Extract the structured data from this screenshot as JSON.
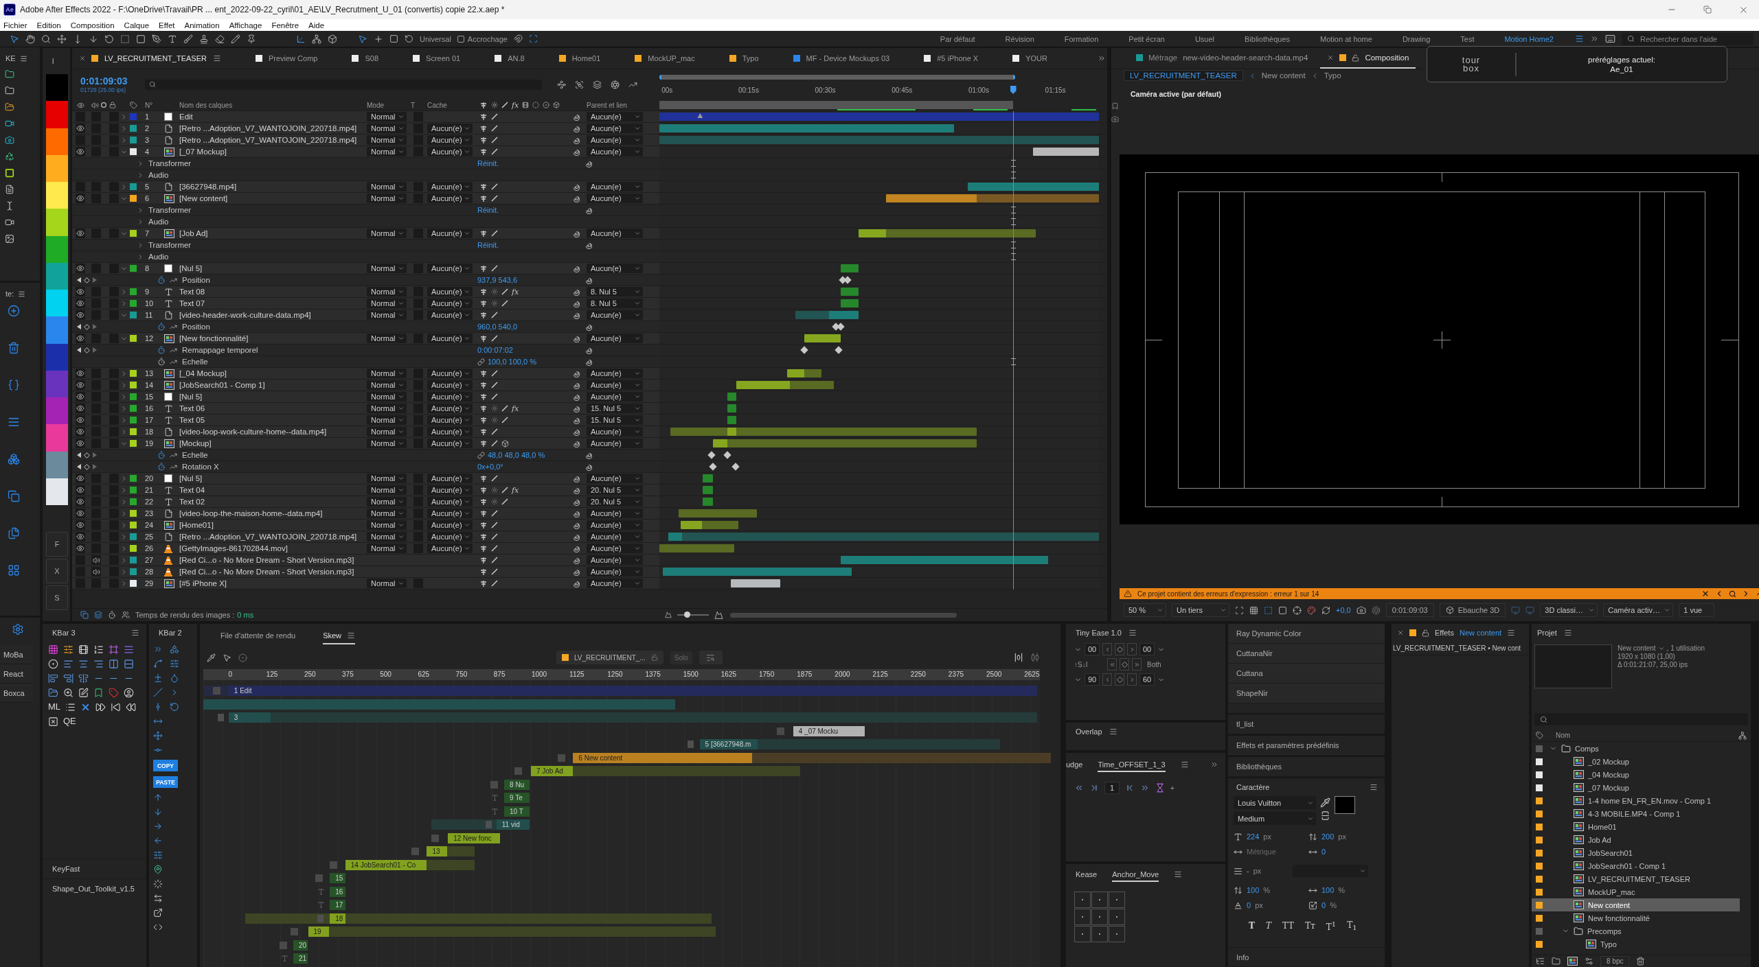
{
  "window": {
    "logo": "Ae",
    "title": "Adobe After Effects 2022 - F:\\OneDrive\\Travail\\PR ... ent_2022-09-22_cyril\\01_AE\\LV_Recrutment_U_01 (convertis) copie  22.x.aep *"
  },
  "menu": [
    "Fichier",
    "Edition",
    "Composition",
    "Calque",
    "Effet",
    "Animation",
    "Affichage",
    "Fenêtre",
    "Aide"
  ],
  "toolbar": {
    "snap_mode": "Universal",
    "snapping": {
      "label": "Accrochage",
      "checked": false
    },
    "workspaces": [
      {
        "label": "Par défaut",
        "selected": false
      },
      {
        "label": "Révision",
        "selected": false
      },
      {
        "label": "Formation",
        "selected": false
      },
      {
        "label": "Petit écran",
        "selected": false
      },
      {
        "label": "Usuel",
        "selected": false
      },
      {
        "label": "Bibliothèques",
        "selected": false
      },
      {
        "label": "Motion at home",
        "selected": false
      },
      {
        "label": "Drawing",
        "selected": false
      },
      {
        "label": "Test",
        "selected": false
      },
      {
        "label": "Motion Home2",
        "selected": true
      }
    ],
    "help_search": {
      "placeholder": "Rechercher dans l'aide"
    }
  },
  "side_strip": {
    "top_title": "KE",
    "middle_title": "te:",
    "buttons": [
      "MoBa",
      "React",
      "Boxca"
    ]
  },
  "label_palette": {
    "title": "l",
    "swatches": [
      {
        "color": "#000000"
      },
      {
        "color": "#e60000"
      },
      {
        "color": "#ff6a00"
      },
      {
        "color": "#ffad1f"
      },
      {
        "color": "#ffe94d"
      },
      {
        "color": "#a6d61c"
      },
      {
        "color": "#20ab26"
      },
      {
        "color": "#11a39b"
      },
      {
        "color": "#00d2f0"
      },
      {
        "color": "#2a86ec"
      },
      {
        "color": "#1c2fab"
      },
      {
        "color": "#6a33bd"
      },
      {
        "color": "#a523b4"
      },
      {
        "color": "#e93a9c"
      },
      {
        "color": "#6b8a9b"
      },
      {
        "color": "#e4e8ec"
      }
    ],
    "buttons": [
      "F",
      "X",
      "S"
    ]
  },
  "timeline": {
    "tabs": [
      {
        "label": "LV_RECRUITMENT_TEASER",
        "color": "#f5a623",
        "selected": true
      },
      {
        "label": "Preview Comp",
        "color": "#eeeeee",
        "selected": false
      },
      {
        "label": "S08",
        "color": "#eeeeee",
        "selected": false
      },
      {
        "label": "Screen 01",
        "color": "#eeeeee",
        "selected": false
      },
      {
        "label": "AN.8",
        "color": "#eeeeee",
        "selected": false
      },
      {
        "label": "Home01",
        "color": "#f5a623",
        "selected": false
      },
      {
        "label": "MockUP_mac",
        "color": "#f5a623",
        "selected": false
      },
      {
        "label": "Typo",
        "color": "#f5a623",
        "selected": false
      },
      {
        "label": "MF - Device Mockups 03",
        "color": "#2a86ec",
        "selected": false
      },
      {
        "label": "#5 iPhone X",
        "color": "#eeeeee",
        "selected": false
      },
      {
        "label": "YOUR",
        "color": "#eeeeee",
        "selected": false
      }
    ],
    "current_time": "0:01:09:03",
    "frame_info": "01728 (25.00 ips)",
    "ruler": [
      "00s",
      "00:15s",
      "00:30s",
      "00:45s",
      "01:00s",
      "01:15s"
    ],
    "columns": {
      "number": "N°",
      "name": "Nom des calques",
      "mode": "Mode",
      "track_matte": "T",
      "matte": "Cache",
      "effects": "fx",
      "parent": "Parent et lien"
    },
    "layers": [
      {
        "number": "1",
        "name": "Edit",
        "kind": "solid",
        "color": "#1f35c0",
        "visible": false,
        "audio": false,
        "expanded": false,
        "fx": false,
        "three_d": false,
        "mode": "Normal",
        "parent": "Aucun(e)"
      },
      {
        "number": "2",
        "name": "[Retro ...Adoption_V7_WANTOJOIN_220718.mp4]",
        "kind": "footage",
        "color": "#1a9a94",
        "visible": true,
        "audio": false,
        "expanded": false,
        "fx": false,
        "three_d": false,
        "mode": "Normal",
        "cache": "Aucun(e)",
        "parent": "Aucun(e)"
      },
      {
        "number": "3",
        "name": "[Retro ...Adoption_V7_WANTOJOIN_220718.mp4]",
        "kind": "footage",
        "color": "#1a9a94",
        "visible": false,
        "audio": false,
        "expanded": false,
        "fx": false,
        "three_d": false,
        "mode": "Normal",
        "cache": "Aucun(e)",
        "parent": "Aucun(e)"
      },
      {
        "number": "4",
        "name": "[_07 Mockup]",
        "kind": "comp",
        "color": "#e8e8e8",
        "visible": true,
        "audio": false,
        "expanded": true,
        "fx": false,
        "three_d": false,
        "mode": "Normal",
        "cache": "Aucun(e)",
        "parent": "Aucun(e)",
        "children": [
          {
            "name": "Transformer",
            "kind": "group",
            "value": "Réinit."
          },
          {
            "name": "Audio",
            "kind": "group"
          }
        ]
      },
      {
        "number": "5",
        "name": "[36627948.mp4]",
        "kind": "footage",
        "color": "#1a9a94",
        "visible": false,
        "audio": false,
        "expanded": false,
        "fx": false,
        "three_d": false,
        "mode": "Normal",
        "cache": "Aucun(e)",
        "parent": "Aucun(e)"
      },
      {
        "number": "6",
        "name": "[New content]",
        "kind": "comp",
        "color": "#f5a41f",
        "visible": true,
        "audio": false,
        "expanded": true,
        "fx": false,
        "three_d": false,
        "mode": "Normal",
        "cache": "Aucun(e)",
        "parent": "Aucun(e)",
        "children": [
          {
            "name": "Transformer",
            "kind": "group",
            "value": "Réinit."
          },
          {
            "name": "Audio",
            "kind": "group"
          }
        ]
      },
      {
        "number": "7",
        "name": "[Job Ad]",
        "kind": "comp",
        "color": "#a6d11c",
        "visible": true,
        "audio": false,
        "expanded": true,
        "fx": false,
        "three_d": false,
        "mode": "Normal",
        "cache": "Aucun(e)",
        "parent": "Aucun(e)",
        "children": [
          {
            "name": "Transformer",
            "kind": "group",
            "value": "Réinit."
          },
          {
            "name": "Audio",
            "kind": "group"
          }
        ]
      },
      {
        "number": "8",
        "name": "[Nul 5]",
        "kind": "solid",
        "color": "#26a82d",
        "visible": true,
        "audio": false,
        "expanded": true,
        "fx": false,
        "three_d": false,
        "mode": "Normal",
        "cache": "Aucun(e)",
        "parent": "Aucun(e)",
        "children": [
          {
            "name": "Position",
            "kind": "property",
            "value": "937,9 543,6",
            "keyframed": true,
            "linked": false
          }
        ]
      },
      {
        "number": "9",
        "name": "Text 08",
        "kind": "text",
        "color": "#26a82d",
        "visible": true,
        "audio": false,
        "expanded": false,
        "fx": true,
        "fx_label": "fx",
        "three_d": false,
        "mode": "Normal",
        "cache": "Aucun(e)",
        "parent": "8. Nul 5"
      },
      {
        "number": "10",
        "name": "Text 07",
        "kind": "text",
        "color": "#26a82d",
        "visible": true,
        "audio": false,
        "expanded": false,
        "fx": false,
        "three_d": false,
        "mode": "Normal",
        "cache": "Aucun(e)",
        "parent": "8. Nul 5"
      },
      {
        "number": "11",
        "name": "[video-header-work-culture-data.mp4]",
        "kind": "footage",
        "color": "#1a9a94",
        "visible": true,
        "audio": false,
        "expanded": true,
        "fx": false,
        "three_d": false,
        "mode": "Normal",
        "cache": "Aucun(e)",
        "parent": "Aucun(e)",
        "children": [
          {
            "name": "Position",
            "kind": "property",
            "value": "960,0 540,0",
            "keyframed": true,
            "linked": false
          }
        ]
      },
      {
        "number": "12",
        "name": "[New fonctionnalité]",
        "kind": "comp",
        "color": "#a6d11c",
        "visible": true,
        "audio": false,
        "expanded": true,
        "fx": false,
        "three_d": false,
        "mode": "Normal",
        "cache": "Aucun(e)",
        "parent": "Aucun(e)",
        "children": [
          {
            "name": "Remappage temporel",
            "kind": "property",
            "value": "0:00:07:02",
            "keyframed": true,
            "linked": false
          },
          {
            "name": "Echelle",
            "kind": "property",
            "value": "100,0 100,0 %",
            "keyframed": false,
            "linked": true
          }
        ]
      },
      {
        "number": "13",
        "name": "[_04 Mockup]",
        "kind": "comp",
        "color": "#a6d11c",
        "visible": true,
        "audio": false,
        "expanded": false,
        "fx": false,
        "three_d": false,
        "mode": "Normal",
        "cache": "Aucun(e)",
        "parent": "Aucun(e)"
      },
      {
        "number": "14",
        "name": "[JobSearch01 - Comp 1]",
        "kind": "comp",
        "color": "#a6d11c",
        "visible": true,
        "audio": false,
        "expanded": false,
        "fx": false,
        "three_d": false,
        "mode": "Normal",
        "cache": "Aucun(e)",
        "parent": "Aucun(e)"
      },
      {
        "number": "15",
        "name": "[Nul 5]",
        "kind": "solid",
        "color": "#26a82d",
        "visible": true,
        "audio": false,
        "expanded": false,
        "fx": false,
        "three_d": false,
        "mode": "Normal",
        "cache": "Aucun(e)",
        "parent": "Aucun(e)"
      },
      {
        "number": "16",
        "name": "Text 06",
        "kind": "text",
        "color": "#26a82d",
        "visible": true,
        "audio": false,
        "expanded": false,
        "fx": true,
        "fx_label": "fx",
        "three_d": false,
        "mode": "Normal",
        "cache": "Aucun(e)",
        "parent": "15. Nul 5"
      },
      {
        "number": "17",
        "name": "Text 05",
        "kind": "text",
        "color": "#26a82d",
        "visible": true,
        "audio": false,
        "expanded": false,
        "fx": false,
        "three_d": false,
        "mode": "Normal",
        "cache": "Aucun(e)",
        "parent": "15. Nul 5"
      },
      {
        "number": "18",
        "name": "[video-loop-work-culture-home--data.mp4]",
        "kind": "footage",
        "color": "#a6d11c",
        "visible": true,
        "audio": false,
        "expanded": false,
        "fx": false,
        "three_d": false,
        "mode": "Normal",
        "cache": "Aucun(e)",
        "parent": "Aucun(e)"
      },
      {
        "number": "19",
        "name": "[Mockup]",
        "kind": "comp",
        "color": "#a6d11c",
        "visible": true,
        "audio": false,
        "expanded": true,
        "fx": false,
        "three_d": true,
        "mode": "Normal",
        "cache": "Aucun(e)",
        "parent": "Aucun(e)",
        "children": [
          {
            "name": "Echelle",
            "kind": "property",
            "value": "48,0 48,0 48,0 %",
            "keyframed": true,
            "linked": true
          },
          {
            "name": "Rotation X",
            "kind": "property",
            "value": "0x+0,0°",
            "keyframed": true,
            "linked": false
          }
        ]
      },
      {
        "number": "20",
        "name": "[Nul 5]",
        "kind": "solid",
        "color": "#26a82d",
        "visible": true,
        "audio": false,
        "expanded": false,
        "fx": false,
        "three_d": false,
        "mode": "Normal",
        "cache": "Aucun(e)",
        "parent": "Aucun(e)"
      },
      {
        "number": "21",
        "name": "Text 04",
        "kind": "text",
        "color": "#26a82d",
        "visible": true,
        "audio": false,
        "expanded": false,
        "fx": true,
        "fx_label": "fx",
        "three_d": false,
        "mode": "Normal",
        "cache": "Aucun(e)",
        "parent": "20. Nul 5"
      },
      {
        "number": "22",
        "name": "Text 02",
        "kind": "text",
        "color": "#26a82d",
        "visible": true,
        "audio": false,
        "expanded": false,
        "fx": false,
        "three_d": false,
        "mode": "Normal",
        "cache": "Aucun(e)",
        "parent": "20. Nul 5"
      },
      {
        "number": "23",
        "name": "[video-loop-the-maison-home--data.mp4]",
        "kind": "footage",
        "color": "#a6d11c",
        "visible": true,
        "audio": false,
        "expanded": false,
        "fx": false,
        "three_d": false,
        "mode": "Normal",
        "cache": "Aucun(e)",
        "parent": "Aucun(e)"
      },
      {
        "number": "24",
        "name": "[Home01]",
        "kind": "comp",
        "color": "#a6d11c",
        "visible": true,
        "audio": false,
        "expanded": false,
        "fx": false,
        "three_d": false,
        "mode": "Normal",
        "cache": "Aucun(e)",
        "parent": "Aucun(e)"
      },
      {
        "number": "25",
        "name": "[Retro ...Adoption_V7_WANTOJOIN_220718.mp4]",
        "kind": "footage",
        "color": "#1a9a94",
        "visible": true,
        "audio": false,
        "expanded": false,
        "fx": false,
        "three_d": false,
        "mode": "Normal",
        "cache": "Aucun(e)",
        "parent": "Aucun(e)"
      },
      {
        "number": "26",
        "name": "[GettyImages-861702844.mov]",
        "kind": "media",
        "color": "#a6d11c",
        "visible": true,
        "audio": false,
        "expanded": false,
        "fx": false,
        "three_d": false,
        "mode": "Normal",
        "cache": "Aucun(e)",
        "parent": "Aucun(e)"
      },
      {
        "number": "27",
        "name": "[Red Ci...o - No More Dream - Short Version.mp3]",
        "kind": "media",
        "color": "#1a9a94",
        "visible": false,
        "audio": true,
        "expanded": false,
        "fx": false,
        "three_d": false,
        "parent": "Aucun(e)"
      },
      {
        "number": "28",
        "name": "[Red Ci...o - No More Dream - Short Version.mp3]",
        "kind": "media",
        "color": "#1a9a94",
        "visible": false,
        "audio": true,
        "expanded": false,
        "fx": false,
        "three_d": false,
        "parent": "Aucun(e)"
      },
      {
        "number": "29",
        "name": "[#5 iPhone X]",
        "kind": "comp",
        "color": "#e6ecf0",
        "visible": false,
        "audio": false,
        "expanded": false,
        "fx": false,
        "three_d": false,
        "mode": "Normal",
        "parent": "Aucun(e)"
      }
    ],
    "zoom_slider": {
      "level": 0.3
    },
    "render_time": {
      "label": "Temps de rendu des images :",
      "value": "0 ms"
    }
  },
  "viewer": {
    "tabs": [
      {
        "kind": "footage",
        "label": "Métrage",
        "file": "new-video-header-search-data.mp4",
        "color": "#1a9a94",
        "selected": false
      },
      {
        "kind": "composition",
        "label": "Composition",
        "color": "#f5a623",
        "selected": true
      }
    ],
    "breadcrumbs": [
      {
        "label": "LV_RECRUITMENT_TEASER",
        "selected": true
      },
      {
        "label": "New content",
        "selected": false
      },
      {
        "label": "Typo",
        "selected": false
      }
    ],
    "camera_label": "Caméra active (par défaut)",
    "warning": "Ce projet contient des erreurs d'expression : erreur 1 sur 14",
    "controls": {
      "zoom": "50 %",
      "grid": "Un tiers",
      "exposure": "+0,0",
      "time": "0:01:09:03",
      "draft": "Ebauche 3D",
      "renderer": "3D classi…",
      "camera": "Caméra activ…",
      "views": "1 vue"
    }
  },
  "tourbox_popup": {
    "logo": [
      "tour",
      "box"
    ],
    "title": "préréglages actuel:",
    "value": "Ae_01"
  },
  "kbar3": {
    "title": "KBar 3",
    "labels": [
      "ML",
      "QE"
    ],
    "buttons": [
      "KeyFast",
      "Shape_Out_Toolkit_v1.5"
    ]
  },
  "kbar2": {
    "title": "KBar 2",
    "labels": [
      "COPY",
      "PASTE"
    ]
  },
  "skew": {
    "tabs": [
      {
        "label": "File d'attente de rendu",
        "selected": false
      },
      {
        "label": "Skew",
        "selected": true
      }
    ],
    "comp": "LV_RECRUITMENT_...",
    "solo": "Solo",
    "ruler": [
      "0",
      "125",
      "250",
      "375",
      "500",
      "625",
      "750",
      "875",
      "1000",
      "1125",
      "1250",
      "1375",
      "1500",
      "1625",
      "1750",
      "1875",
      "2000",
      "2125",
      "2250",
      "2375",
      "2500",
      "2625"
    ],
    "rows": [
      {
        "label": "1  Edit",
        "kind": "solid"
      },
      {
        "kind": "plain"
      },
      {
        "label": "3",
        "kind": "footage"
      },
      {
        "label": "4  _07 Mocku",
        "kind": "solid"
      },
      {
        "label": "5  [36627948.m",
        "kind": "footage"
      },
      {
        "label": "6  New content",
        "kind": "solid"
      },
      {
        "label": "7  Job Ad",
        "kind": "solid"
      },
      {
        "label": "8  Nu",
        "kind": "solid"
      },
      {
        "label": "9  Te",
        "kind": "text"
      },
      {
        "label": "10  T",
        "kind": "text"
      },
      {
        "label": "11  vid",
        "kind": "footage"
      },
      {
        "label": "12  New fonc",
        "kind": "solid"
      },
      {
        "label": "13",
        "kind": "solid"
      },
      {
        "label": "14  JobSearch01 - Co",
        "kind": "solid"
      },
      {
        "label": "15",
        "kind": "solid"
      },
      {
        "label": "16",
        "kind": "text"
      },
      {
        "label": "17",
        "kind": "text"
      },
      {
        "label": "18",
        "kind": "footage"
      },
      {
        "label": "19",
        "kind": "solid"
      },
      {
        "label": "20",
        "kind": "solid"
      },
      {
        "label": "21",
        "kind": "text"
      }
    ]
  },
  "tiny_ease": {
    "title": "Tiny Ease 1.0",
    "fields": [
      "00",
      "00",
      "90",
      "60"
    ],
    "mode_label": "↑S↓I",
    "both": "Both"
  },
  "overlap": {
    "title": "Overlap"
  },
  "offset_panel": {
    "tabs": [
      {
        "label": "udge",
        "selected": false
      },
      {
        "label": "Time_OFFSET_1_3",
        "selected": true
      }
    ],
    "frames": "1",
    "add": "+"
  },
  "kease": {
    "tabs": [
      {
        "label": "Kease",
        "selected": false
      },
      {
        "label": "Anchor_Move",
        "selected": true
      }
    ]
  },
  "scripts": {
    "items": [
      "Ray Dynamic Color",
      "CuttanaNir",
      "Cuttana",
      "ShapeNir"
    ],
    "panels": [
      "tl_list",
      "Effets et paramètres prédéfinis",
      "Bibliothèques"
    ]
  },
  "character": {
    "title": "Caractère",
    "font": "Louis Vuitton",
    "style": "Medium",
    "size": {
      "value": "224",
      "unit": "px"
    },
    "leading": {
      "value": "200",
      "unit": "px"
    },
    "kerning": "Métrique",
    "tracking": "0",
    "stroke": {
      "value": "-",
      "unit": "px"
    },
    "vertical_scale": {
      "value": "100",
      "unit": "%"
    },
    "horizontal_scale": {
      "value": "100",
      "unit": "%"
    },
    "baseline": {
      "value": "0",
      "unit": "px"
    },
    "tsume": {
      "value": "0",
      "unit": "%"
    },
    "styles": [
      {
        "label": "T",
        "kind": "bold"
      },
      {
        "label": "T",
        "kind": "italic"
      },
      {
        "label": "TT",
        "kind": "caps"
      },
      {
        "label": "Tᴛ",
        "kind": "small_caps"
      },
      {
        "label": "T$^{1}$",
        "kind": "super"
      },
      {
        "label": "T$_{1}$",
        "kind": "sub"
      }
    ]
  },
  "info": {
    "title": "Info"
  },
  "effects": {
    "title": "Effets",
    "layer": "New content",
    "path": "LV_RECRUITMENT_TEASER • New cont"
  },
  "project": {
    "title": "Projet",
    "selection": {
      "name": "New content",
      "usage": ", 1 utilisation",
      "size": "1920 x 1080 (1,00)",
      "duration": "Δ 0:01:21:07, 25,00 ips"
    },
    "column": "Nom",
    "items": [
      {
        "name": "Comps",
        "kind": "folder",
        "color": "#5c5c5c",
        "expanded": true,
        "selected": false,
        "children": [
          {
            "name": "_02 Mockup",
            "kind": "comp",
            "color": "#e8e8e8",
            "selected": false
          },
          {
            "name": "_04 Mockup",
            "kind": "comp",
            "color": "#e8e8e8",
            "selected": false
          },
          {
            "name": "_07 Mockup",
            "kind": "comp",
            "color": "#e8e8e8",
            "selected": false
          },
          {
            "name": "1-4 home EN_FR_EN.mov - Comp 1",
            "kind": "comp",
            "color": "#f5a623",
            "selected": false
          },
          {
            "name": "4-3 MOBILE.MP4 - Comp 1",
            "kind": "comp",
            "color": "#f5a623",
            "selected": false
          },
          {
            "name": "Home01",
            "kind": "comp",
            "color": "#f5a623",
            "selected": false
          },
          {
            "name": "Job Ad",
            "kind": "comp",
            "color": "#f5a623",
            "selected": false
          },
          {
            "name": "JobSearch01",
            "kind": "comp",
            "color": "#f5a623",
            "selected": false
          },
          {
            "name": "JobSearch01 - Comp 1",
            "kind": "comp",
            "color": "#f5a623",
            "selected": false
          },
          {
            "name": "LV_RECRUITMENT_TEASER",
            "kind": "comp",
            "color": "#f5a623",
            "selected": false
          },
          {
            "name": "MockUP_mac",
            "kind": "comp",
            "color": "#f5a623",
            "selected": false
          },
          {
            "name": "New content",
            "kind": "comp",
            "color": "#f5a623",
            "selected": true
          },
          {
            "name": "New fonctionnalité",
            "kind": "comp",
            "color": "#f5a623",
            "selected": false
          },
          {
            "name": "Precomps",
            "kind": "folder",
            "color": "#5c5c5c",
            "expanded": true,
            "selected": false,
            "children": [
              {
                "name": "Typo",
                "kind": "comp",
                "color": "#f5a623",
                "selected": false
              }
            ]
          }
        ]
      }
    ],
    "bit_depth": "8 bpc"
  }
}
